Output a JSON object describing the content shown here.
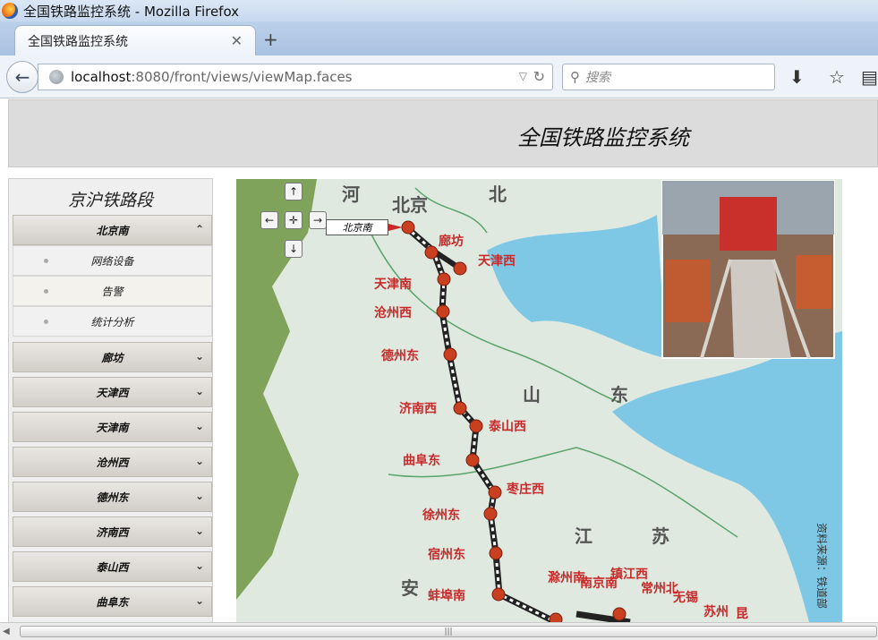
{
  "window": {
    "title": "全国铁路监控系统 - Mozilla Firefox"
  },
  "tabs": [
    {
      "label": "全国铁路监控系统"
    }
  ],
  "nav": {
    "url_host": "localhost",
    "url_rest": ":8080/front/views/viewMap.faces",
    "search_placeholder": "搜索"
  },
  "header": {
    "title": "全国铁路监控系统"
  },
  "sidebar": {
    "title": "京沪铁路段",
    "items": [
      {
        "label": "北京南",
        "expanded": true,
        "children": [
          {
            "label": "网络设备"
          },
          {
            "label": "告警"
          },
          {
            "label": "统计分析"
          }
        ]
      },
      {
        "label": "廊坊"
      },
      {
        "label": "天津西"
      },
      {
        "label": "天津南"
      },
      {
        "label": "沧州西"
      },
      {
        "label": "德州东"
      },
      {
        "label": "济南西"
      },
      {
        "label": "泰山西"
      },
      {
        "label": "曲阜东"
      }
    ]
  },
  "map": {
    "selected_station_label": "北京南",
    "provinces": [
      "河",
      "北京",
      "北",
      "山",
      "东",
      "江",
      "苏",
      "安"
    ],
    "stations": [
      "廊坊",
      "天津西",
      "天津南",
      "沧州西",
      "德州东",
      "济南西",
      "泰山西",
      "曲阜东",
      "枣庄西",
      "徐州东",
      "宿州东",
      "蚌埠南",
      "滁州南",
      "南京南",
      "镇江西",
      "常州北",
      "无锡",
      "苏州",
      "昆"
    ],
    "source_note": "资料来源：铁道部",
    "colors": {
      "sea": "#7ec8e6",
      "land": "#dfe9e0",
      "green": "#7fa35a",
      "station": "#c82a2a"
    }
  }
}
